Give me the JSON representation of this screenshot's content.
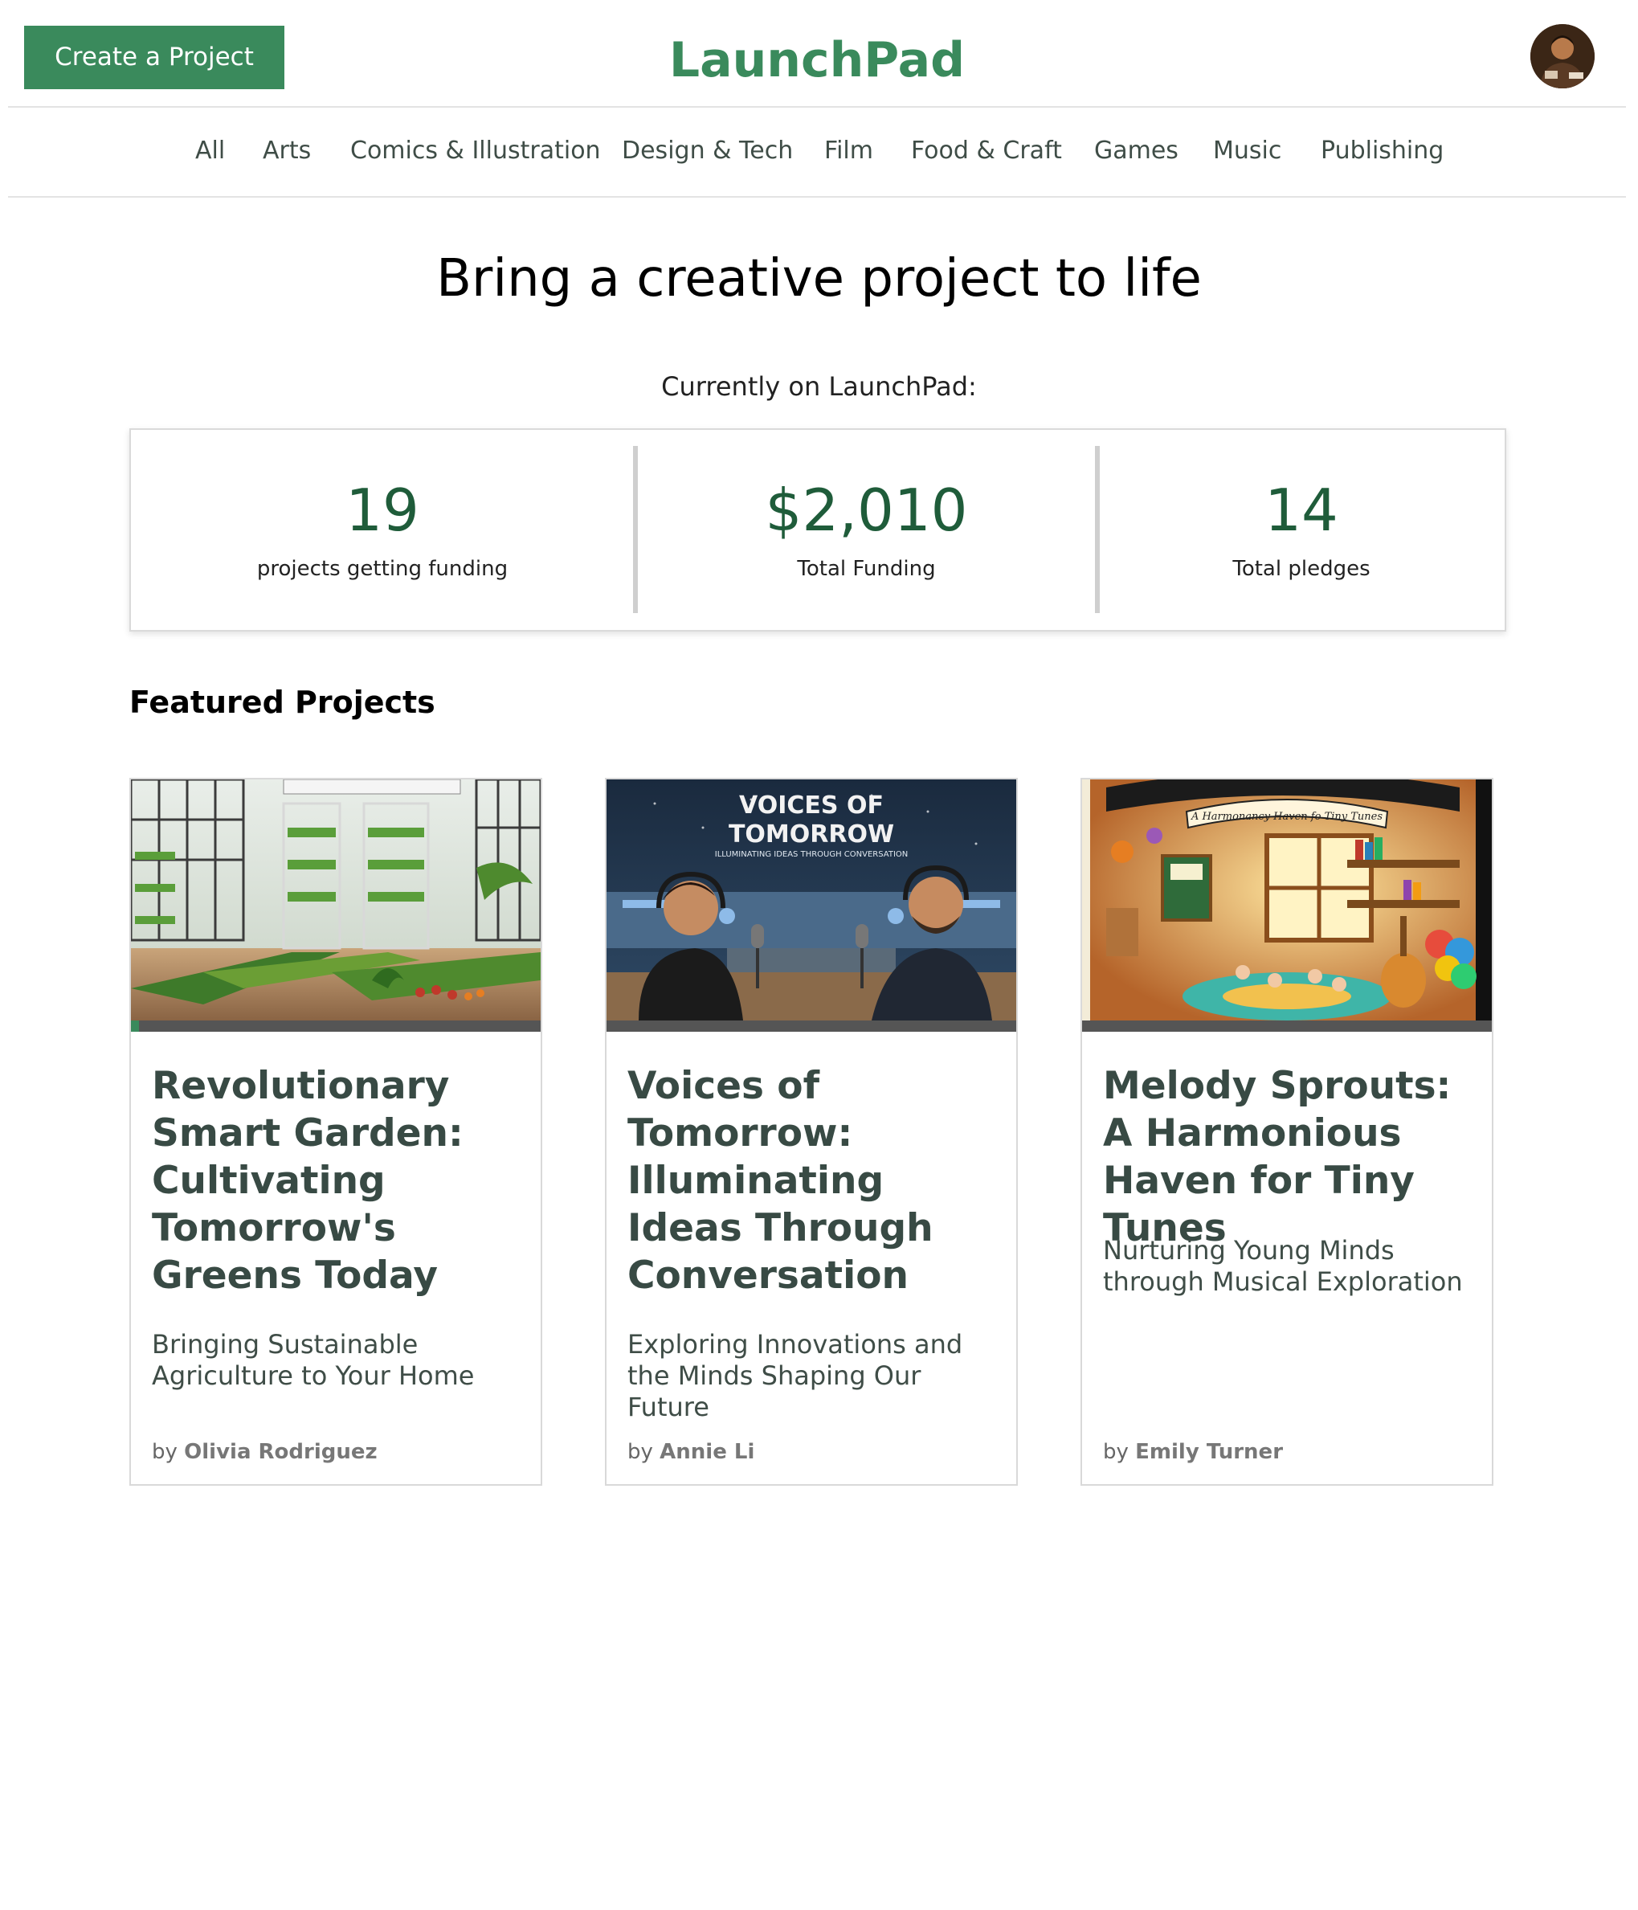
{
  "header": {
    "create_button": "Create a Project",
    "brand": "LaunchPad"
  },
  "nav": {
    "items": [
      "All",
      "Arts",
      "Comics & Illustration",
      "Design & Tech",
      "Film",
      "Food & Craft",
      "Games",
      "Music",
      "Publishing"
    ]
  },
  "hero": {
    "title": "Bring a creative project to life",
    "currently": "Currently on LaunchPad:"
  },
  "stats": [
    {
      "value": "19",
      "label": "projects getting funding"
    },
    {
      "value": "$2,010",
      "label": "Total Funding"
    },
    {
      "value": "14",
      "label": "Total pledges"
    }
  ],
  "featured": {
    "heading": "Featured Projects",
    "projects": [
      {
        "title": "Revolutionary Smart Garden: Cultivating Tomorrow's Greens Today",
        "description": "Bringing Sustainable Agriculture to Your Home",
        "by": "by",
        "author": "Olivia Rodriguez",
        "progress": 0.02,
        "image_icon": "smart-garden-image"
      },
      {
        "title": "Voices of Tomorrow: Illuminating Ideas Through Conversation",
        "description": "Exploring Innovations and the Minds Shaping Our Future",
        "by": "by",
        "author": "Annie Li",
        "progress": 0,
        "image_icon": "podcast-image",
        "image_text": {
          "headline_1": "VOICES OF",
          "headline_2": "TOMORROW",
          "subline": "ILLUMINATING IDEAS THROUGH CONVERSATION"
        }
      },
      {
        "title": "Melody Sprouts: A Harmonious Haven for Tiny Tunes",
        "description": "Nurturing Young Minds through Musical Exploration",
        "by": "by",
        "author": "Emily Turner",
        "progress": 0,
        "image_icon": "music-nursery-image",
        "image_text": {
          "banner": "A Harmonancy Haven fo Tiny Tunes"
        }
      }
    ]
  },
  "colors": {
    "brand": "#3a8a5c",
    "stat_value": "#1f5c3a",
    "card_title": "#384a44",
    "progress_track": "#555555"
  }
}
